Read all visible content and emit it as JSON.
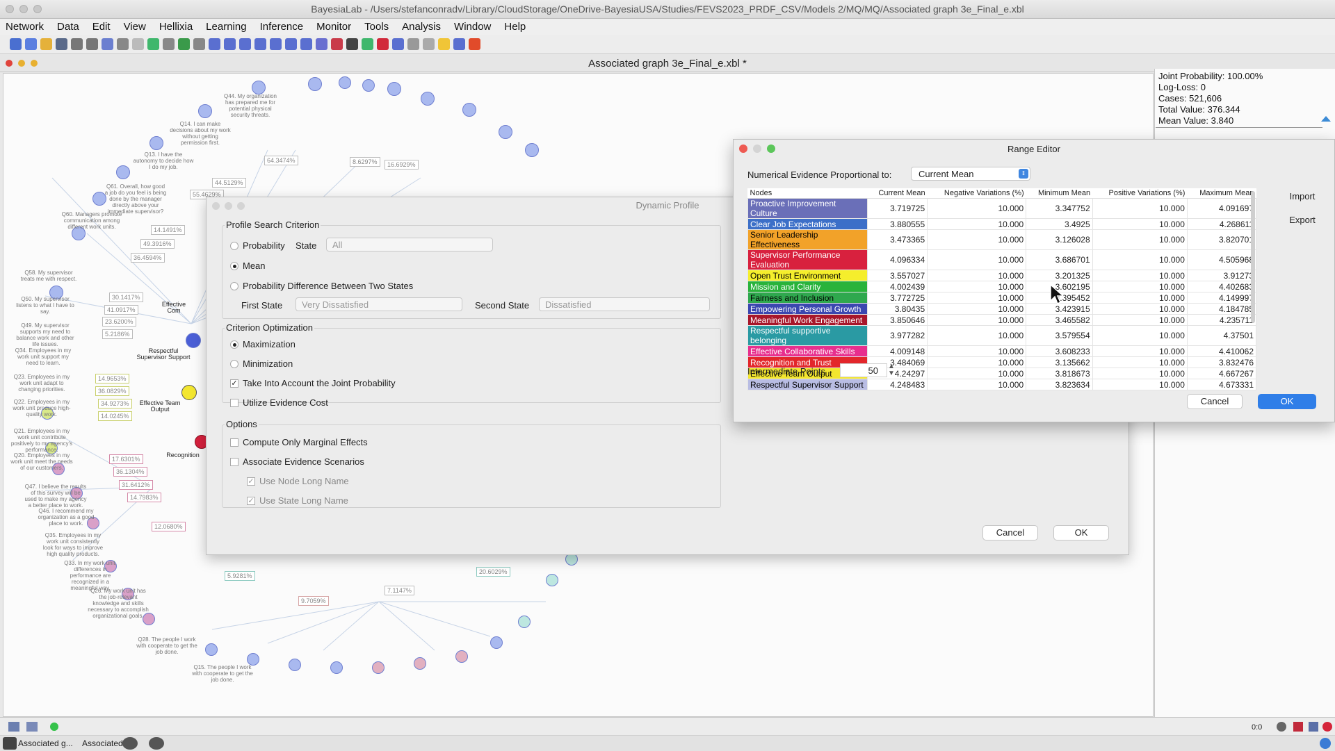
{
  "window": {
    "title": "BayesiaLab - /Users/stefanconradv/Library/CloudStorage/OneDrive-BayesiaUSA/Studies/FEVS2023_PRDF_CSV/Models 2/MQ/MQ/Associated graph 3e_Final_e.xbl"
  },
  "menu": [
    "Network",
    "Data",
    "Edit",
    "View",
    "Hellixia",
    "Learning",
    "Inference",
    "Monitor",
    "Tools",
    "Analysis",
    "Window",
    "Help"
  ],
  "graph_tab": {
    "title": "Associated graph 3e_Final_e.xbl *"
  },
  "canvas_labels": {
    "q44": "Q44. My organization has prepared me for potential physical security threats.",
    "q14": "Q14. I can make decisions about my work without getting permission first.",
    "q13": "Q13. I have the autonomy to decide how I do my job.",
    "q61": "Q61. Overall, how good a job do you feel is being done by the manager directly above your immediate supervisor?",
    "q60": "Q60. Managers promote communication among different work units.",
    "q58": "Q58. My supervisor treats me with respect.",
    "q50": "Q50. My supervisor listens to what I have to say.",
    "q49": "Q49. My supervisor supports my need to balance work and other life issues.",
    "q34": "Q34. Employees in my work unit support my need to learn.",
    "q23": "Q23. Employees in my work unit adapt to changing priorities.",
    "q22": "Q22. Employees in my work unit produce high-quality work.",
    "q21": "Q21. Employees in my work unit contribute positively to my agency's performance.",
    "q20": "Q20. Employees in my work unit meet the needs of our customers.",
    "q47": "Q47. I believe the results of this survey will be used to make my agency a better place to work.",
    "q46": "Q46. I recommend my organization as a good place to work.",
    "q35": "Q35. Employees in my work unit consistently look for ways to improve high quality products.",
    "q33": "Q33. In my work unit, differences in performance are recognized in a meaningful way.",
    "q28": "Q28. The people I work with cooperate to get the job done.",
    "q26": "Q26. My work unit has the job-relevant knowledge and skills necessary to accomplish organizational goals.",
    "q15": "Q15. The people I work with cooperate to get the job done.",
    "effective_com": "Effective Com",
    "respectful_sup": "Respectful Supervisor Support",
    "effective_team": "Effective Team Output",
    "recognition": "Recognition"
  },
  "canvas_boxes": [
    "64.3474%",
    "55.4629%",
    "44.5129%",
    "14.1491%",
    "49.3916%",
    "36.4594%",
    "30.1417%",
    "41.0917%",
    "23.6200%",
    "5.2186%",
    "14.9653%",
    "36.0829%",
    "34.9273%",
    "14.0245%",
    "17.6301%",
    "36.1304%",
    "31.6412%",
    "14.7983%",
    "12.0680%",
    "5.9281%",
    "9.7059%",
    "7.1147%",
    "20.6029%",
    "16.6929%",
    "8.6297%"
  ],
  "monitor": {
    "joint_probability": "Joint Probability: 100.00%",
    "log_loss": "Log-Loss: 0",
    "cases": "Cases: 521,606",
    "total_value": "Total Value: 376.344",
    "mean_value": "Mean Value: 3.840"
  },
  "dynamic_profile": {
    "title": "Dynamic Profile",
    "search_criterion_title": "Profile Search Criterion",
    "probability": "Probability",
    "state_label": "State",
    "state_value": "All",
    "mean": "Mean",
    "prob_diff": "Probability Difference Between Two States",
    "first_state_label": "First State",
    "first_state_value": "Very Dissatisfied",
    "second_state_label": "Second State",
    "second_state_value": "Dissatisfied",
    "optimization_title": "Criterion Optimization",
    "maximization": "Maximization",
    "minimization": "Minimization",
    "joint_prob": "Take Into Account the Joint Probability",
    "evidence_cost": "Utilize Evidence Cost",
    "options_title": "Options",
    "marginal": "Compute Only Marginal Effects",
    "scenarios": "Associate Evidence Scenarios",
    "node_long": "Use Node Long Name",
    "state_long": "Use State Long Name",
    "cancel": "Cancel",
    "ok": "OK"
  },
  "range_editor": {
    "title": "Range Editor",
    "proportional_label": "Numerical Evidence Proportional to:",
    "proportional_value": "Current Mean",
    "columns": [
      "Nodes",
      "Current Mean",
      "Negative Variations (%)",
      "Minimum Mean",
      "Positive Variations (%)",
      "Maximum Mean"
    ],
    "rows": [
      {
        "name": "Proactive Improvement Culture",
        "color": "#6a6fb8",
        "text": "#ffffff",
        "cur": "3.719725",
        "neg": "10.000",
        "min": "3.347752",
        "pos": "10.000",
        "max": "4.091697"
      },
      {
        "name": "Clear Job Expectations",
        "color": "#3c6fc8",
        "text": "#ffffff",
        "cur": "3.880555",
        "neg": "10.000",
        "min": "3.4925",
        "pos": "10.000",
        "max": "4.268611"
      },
      {
        "name": "Senior Leadership Effectiveness",
        "color": "#f2a229",
        "text": "#000000",
        "cur": "3.473365",
        "neg": "10.000",
        "min": "3.126028",
        "pos": "10.000",
        "max": "3.820701"
      },
      {
        "name": "Supervisor Performance Evaluation",
        "color": "#d8213e",
        "text": "#ffffff",
        "cur": "4.096334",
        "neg": "10.000",
        "min": "3.686701",
        "pos": "10.000",
        "max": "4.505968"
      },
      {
        "name": "Open Trust Environment",
        "color": "#f5ee2c",
        "text": "#000000",
        "cur": "3.557027",
        "neg": "10.000",
        "min": "3.201325",
        "pos": "10.000",
        "max": "3.91273"
      },
      {
        "name": "Mission and Clarity",
        "color": "#29b33b",
        "text": "#ffffff",
        "cur": "4.002439",
        "neg": "10.000",
        "min": "3.602195",
        "pos": "10.000",
        "max": "4.402683"
      },
      {
        "name": "Fairness and Inclusion",
        "color": "#2fa84e",
        "text": "#000000",
        "cur": "3.772725",
        "neg": "10.000",
        "min": "3.395452",
        "pos": "10.000",
        "max": "4.149997"
      },
      {
        "name": "Empowering Personal Growth",
        "color": "#3b47b0",
        "text": "#ffffff",
        "cur": "3.80435",
        "neg": "10.000",
        "min": "3.423915",
        "pos": "10.000",
        "max": "4.184785"
      },
      {
        "name": "Meaningful Work Engagement",
        "color": "#a8162a",
        "text": "#ffffff",
        "cur": "3.850646",
        "neg": "10.000",
        "min": "3.465582",
        "pos": "10.000",
        "max": "4.235711"
      },
      {
        "name": "Respectful supportive belonging",
        "color": "#2a9aa3",
        "text": "#ffffff",
        "cur": "3.977282",
        "neg": "10.000",
        "min": "3.579554",
        "pos": "10.000",
        "max": "4.37501"
      },
      {
        "name": "Effective Collaborative Skills",
        "color": "#e72f8e",
        "text": "#ffffff",
        "cur": "4.009148",
        "neg": "10.000",
        "min": "3.608233",
        "pos": "10.000",
        "max": "4.410062"
      },
      {
        "name": "Recognition and Trust",
        "color": "#e3262b",
        "text": "#ffffff",
        "cur": "3.484069",
        "neg": "10.000",
        "min": "3.135662",
        "pos": "10.000",
        "max": "3.832476"
      },
      {
        "name": "Effective Team Output",
        "color": "#f3e62f",
        "text": "#000000",
        "cur": "4.24297",
        "neg": "10.000",
        "min": "3.818673",
        "pos": "10.000",
        "max": "4.667267"
      },
      {
        "name": "Respectful Supervisor Support",
        "color": "#b9bde3",
        "text": "#000000",
        "cur": "4.248483",
        "neg": "10.000",
        "min": "3.823634",
        "pos": "10.000",
        "max": "4.673331"
      }
    ],
    "import": "Import",
    "export": "Export",
    "intermediate_label": "Intermediate Points",
    "intermediate_value": "50",
    "cancel": "Cancel",
    "ok": "OK"
  },
  "status": {
    "zoom": "0:0",
    "tab1": "Associated g...",
    "tab2": "Associated g..."
  }
}
